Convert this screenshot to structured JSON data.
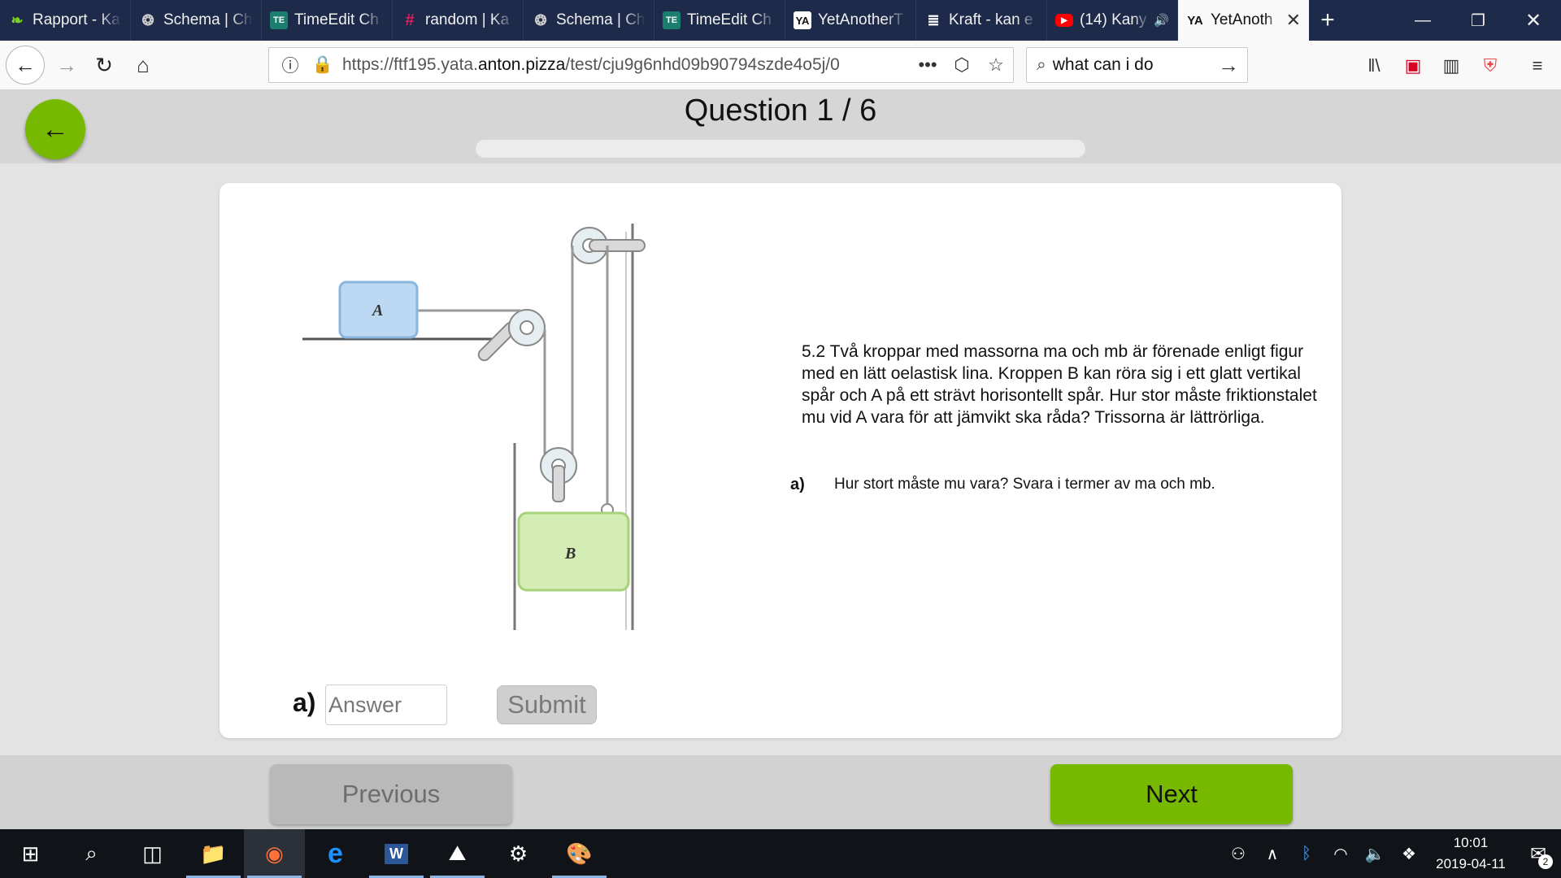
{
  "browser": {
    "tabs": [
      {
        "label": "Rapport - Ka",
        "icon": "leaf-icon",
        "color": "#7ed321"
      },
      {
        "label": "Schema | Ch",
        "icon": "globe-seal-icon",
        "color": "#cccccc"
      },
      {
        "label": "TimeEdit Ch",
        "icon": "timeedit-icon",
        "color": "#1a7f6e"
      },
      {
        "label": "random | Ka",
        "icon": "slack-icon",
        "color": "#e01e5a"
      },
      {
        "label": "Schema | Ch",
        "icon": "globe-seal-icon",
        "color": "#cccccc"
      },
      {
        "label": "TimeEdit Ch",
        "icon": "timeedit-icon",
        "color": "#1a7f6e"
      },
      {
        "label": "YetAnotherT",
        "icon": "yata-icon",
        "color": "#ffffff"
      },
      {
        "label": "Kraft - kan e",
        "icon": "kraft-icon",
        "color": "#ffffff"
      },
      {
        "label": "(14) Kany",
        "icon": "youtube-icon",
        "color": "#ff0000",
        "audio": true
      },
      {
        "label": "YetAnoth",
        "icon": "yata-icon",
        "color": "#111111",
        "active": true
      }
    ],
    "url_prefix": "https://ftf195.yata.",
    "url_domain": "anton.pizza",
    "url_path": "/test/cju9g6nhd09b90794szde4o5j/0",
    "search_value": "what can i do"
  },
  "page": {
    "question_title": "Question 1 / 6",
    "progress": 0.0,
    "question_text": "5.2 Två kroppar med massorna ma och mb är förenade enligt figur med en lätt oelastisk lina. Kroppen B kan röra sig i ett glatt vertikal spår och A på ett strävt horisontellt spår. Hur stor måste friktionstalet mu vid A vara för att jämvikt ska råda? Trissorna är lättrörliga.",
    "subquestion": {
      "label": "a)",
      "text": "Hur stort måste mu vara? Svara i termer av ma och mb."
    },
    "answer": {
      "label": "a)",
      "placeholder": "Answer",
      "value": ""
    },
    "submit_label": "Submit",
    "previous_label": "Previous",
    "next_label": "Next",
    "figure": {
      "block_a_label": "A",
      "block_b_label": "B"
    },
    "accent_color": "#76b900"
  },
  "taskbar": {
    "time": "10:01",
    "date": "2019-04-11",
    "notification_count": "2"
  }
}
